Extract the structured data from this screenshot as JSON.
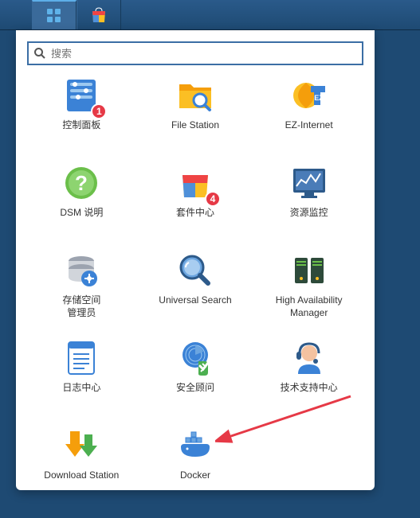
{
  "taskbar": {
    "main_menu_icon": "grid-icon",
    "package_center_icon": "shopping-bag-icon"
  },
  "search": {
    "placeholder": "搜索"
  },
  "apps": [
    {
      "id": "control-panel",
      "label": "控制面板",
      "icon": "control-panel-icon",
      "badge": "1"
    },
    {
      "id": "file-station",
      "label": "File Station",
      "icon": "folder-search-icon",
      "badge": null
    },
    {
      "id": "ez-internet",
      "label": "EZ-Internet",
      "icon": "globe-arrow-icon",
      "badge": null
    },
    {
      "id": "dsm-help",
      "label": "DSM 说明",
      "icon": "help-icon",
      "badge": null
    },
    {
      "id": "package-center",
      "label": "套件中心",
      "icon": "shopping-bag-icon",
      "badge": "4"
    },
    {
      "id": "resource-monitor",
      "label": "资源监控",
      "icon": "monitor-chart-icon",
      "badge": null
    },
    {
      "id": "storage-manager",
      "label": "存储空间\n管理员",
      "icon": "disk-stack-icon",
      "badge": null
    },
    {
      "id": "universal-search",
      "label": "Universal Search",
      "icon": "magnifier-icon",
      "badge": null
    },
    {
      "id": "ha-manager",
      "label": "High Availability Manager",
      "icon": "servers-icon",
      "badge": null
    },
    {
      "id": "log-center",
      "label": "日志中心",
      "icon": "log-list-icon",
      "badge": null
    },
    {
      "id": "security-advisor",
      "label": "安全顾问",
      "icon": "shield-radar-icon",
      "badge": null
    },
    {
      "id": "support-center",
      "label": "技术支持中心",
      "icon": "headset-person-icon",
      "badge": null
    },
    {
      "id": "download-station",
      "label": "Download Station",
      "icon": "download-arrows-icon",
      "badge": null
    },
    {
      "id": "docker",
      "label": "Docker",
      "icon": "docker-whale-icon",
      "badge": null
    }
  ],
  "annotation": {
    "arrow_target": "docker"
  }
}
